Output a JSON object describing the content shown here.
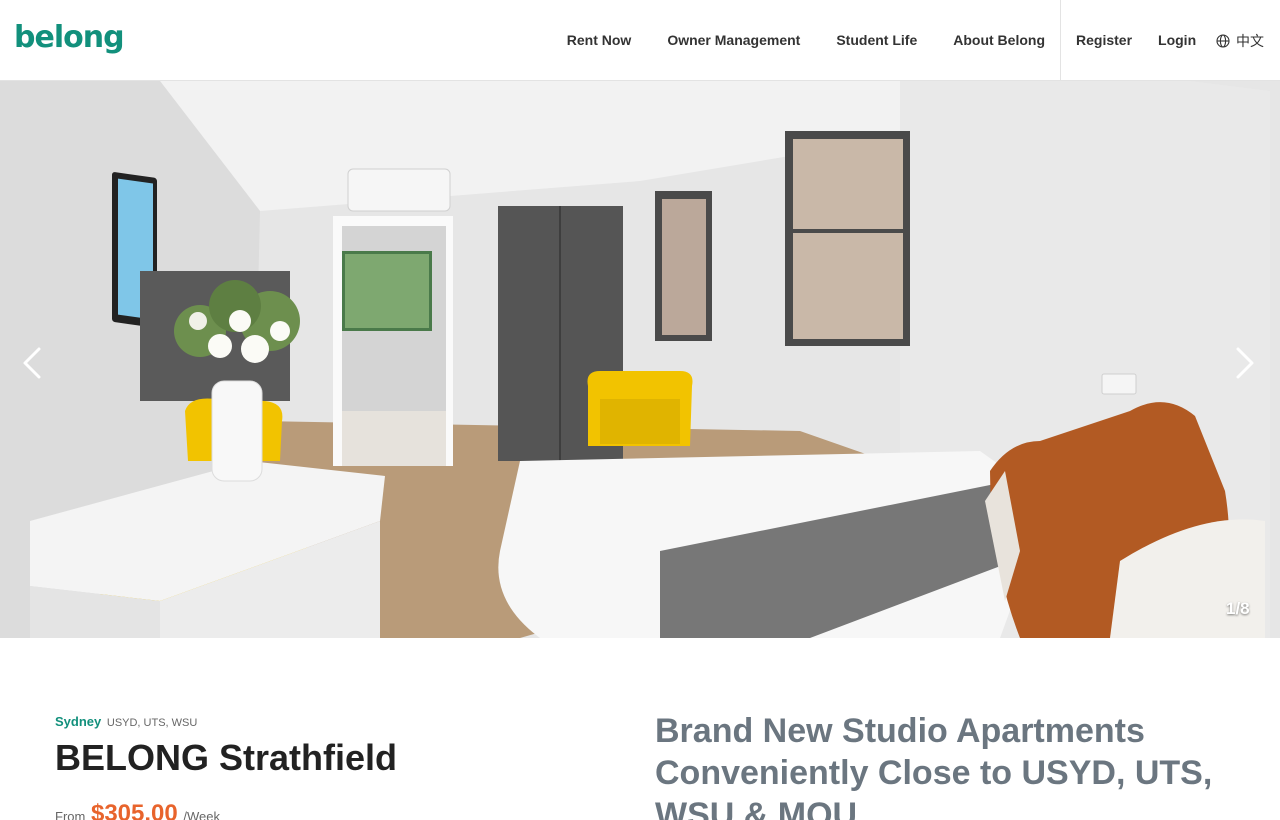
{
  "header": {
    "logo": "belong",
    "nav": [
      "Rent Now",
      "Owner Management",
      "Student Life",
      "About Belong"
    ],
    "register": "Register",
    "login": "Login",
    "language": "中文"
  },
  "hero": {
    "counter": "1/8"
  },
  "property": {
    "city": "Sydney",
    "universities": "USYD, UTS, WSU",
    "title": "BELONG Strathfield",
    "price_prefix": "From",
    "price": "$305.00",
    "price_unit": "/Week",
    "headline": "Brand New Studio Apartments Conveniently Close to USYD, UTS, WSU & MQU"
  },
  "colors": {
    "brand": "#12907c",
    "price": "#e8642c",
    "headline": "#6b7680"
  },
  "icons": {
    "language": "globe-icon",
    "prev": "chevron-left-icon",
    "next": "chevron-right-icon"
  }
}
